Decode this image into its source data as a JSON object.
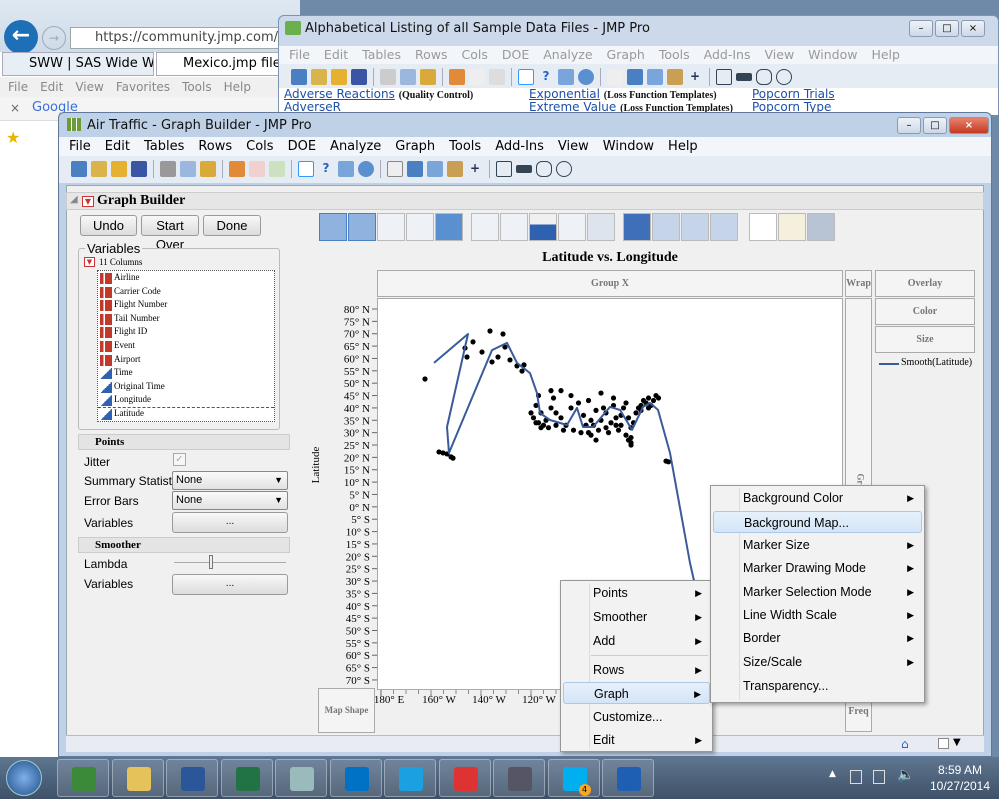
{
  "browser": {
    "address": "https://community.jmp.com/threa",
    "tabs": [
      "SWW | SAS Wide Web",
      "Mexico.jmp file H"
    ],
    "menu": [
      "File",
      "Edit",
      "View",
      "Favorites",
      "Tools",
      "Help"
    ],
    "google_close": "×",
    "google": "Google"
  },
  "listing_window": {
    "title": "Alphabetical Listing of all Sample Data Files - JMP Pro",
    "menu": [
      "File",
      "Edit",
      "Tables",
      "Rows",
      "Cols",
      "DOE",
      "Analyze",
      "Graph",
      "Tools",
      "Add-Ins",
      "View",
      "Window",
      "Help"
    ],
    "links": [
      {
        "name": "Adverse Reactions",
        "note": "(Quality Control)"
      },
      {
        "name": "AdverseR",
        "note": ""
      },
      {
        "name": "Exponential",
        "note": "(Loss Function Templates)"
      },
      {
        "name": "Extreme Value",
        "note": "(Loss Function Templates)"
      },
      {
        "name": "Popcorn Trials",
        "note": ""
      },
      {
        "name": "Popcorn Type",
        "note": ""
      }
    ]
  },
  "main_window": {
    "title": "Air Traffic - Graph Builder - JMP Pro",
    "menu": [
      "File",
      "Edit",
      "Tables",
      "Rows",
      "Cols",
      "DOE",
      "Analyze",
      "Graph",
      "Tools",
      "Add-Ins",
      "View",
      "Window",
      "Help"
    ]
  },
  "graph_builder": {
    "title": "Graph Builder",
    "buttons": {
      "undo": "Undo",
      "start_over": "Start Over",
      "done": "Done"
    },
    "variables_label": "Variables",
    "columns_label": "11 Columns",
    "columns": [
      {
        "name": "Airline",
        "type": "nominal"
      },
      {
        "name": "Carrier Code",
        "type": "nominal"
      },
      {
        "name": "Flight Number",
        "type": "nominal"
      },
      {
        "name": "Tail Number",
        "type": "nominal"
      },
      {
        "name": "Flight ID",
        "type": "nominal"
      },
      {
        "name": "Event",
        "type": "nominal"
      },
      {
        "name": "Airport",
        "type": "nominal"
      },
      {
        "name": "Time",
        "type": "continuous"
      },
      {
        "name": "Original Time",
        "type": "continuous"
      },
      {
        "name": "Longitude",
        "type": "continuous"
      },
      {
        "name": "Latitude",
        "type": "continuous"
      }
    ],
    "points": {
      "section": "Points",
      "jitter_label": "Jitter",
      "jitter_checked": true,
      "summary_label": "Summary Statistic",
      "summary_value": "None",
      "error_label": "Error Bars",
      "error_value": "None",
      "variables_label": "Variables",
      "variables_button": "..."
    },
    "smoother": {
      "section": "Smoother",
      "lambda_label": "Lambda",
      "lambda_value": 0.5,
      "variables_label": "Variables",
      "variables_button": "..."
    },
    "zones": {
      "group_x": "Group X",
      "wrap": "Wrap",
      "overlay": "Overlay",
      "color": "Color",
      "size": "Size",
      "map_shape": "Map Shape",
      "freq": "Freq",
      "group_y": "Gr"
    },
    "legend": "Smooth(Latitude)"
  },
  "chart_data": {
    "type": "scatter",
    "title": "Latitude vs. Longitude",
    "ylabel": "Latitude",
    "xlabel": "",
    "ylim": [
      -70,
      80
    ],
    "y_ticks": [
      "80° N",
      "75° N",
      "70° N",
      "65° N",
      "60° N",
      "55° N",
      "50° N",
      "45° N",
      "40° N",
      "35° N",
      "30° N",
      "25° N",
      "20° N",
      "15° N",
      "10° N",
      "5° N",
      "0° N",
      "5° S",
      "10° S",
      "15° S",
      "20° S",
      "25° S",
      "30° S",
      "35° S",
      "40° S",
      "45° S",
      "50° S",
      "55° S",
      "60° S",
      "65° S",
      "70° S"
    ],
    "x_ticks": [
      {
        "value": -180,
        "label": "180° E"
      },
      {
        "value": -160,
        "label": "160° W"
      },
      {
        "value": -140,
        "label": "140° W"
      },
      {
        "value": -120,
        "label": "120° W"
      }
    ],
    "grid": false,
    "series_color": "#3a5a9a",
    "points": [
      [
        -162.4,
        51.7
      ],
      [
        -146.4,
        64.2
      ],
      [
        -143.2,
        66.7
      ],
      [
        -145.6,
        60.6
      ],
      [
        -136.4,
        71.1
      ],
      [
        -131.2,
        69.9
      ],
      [
        -135.6,
        58.6
      ],
      [
        -139.6,
        62.6
      ],
      [
        -133.2,
        60.6
      ],
      [
        -130.4,
        64.6
      ],
      [
        -128.4,
        59.4
      ],
      [
        -125.6,
        57
      ],
      [
        -123.6,
        54.9
      ],
      [
        -122.8,
        57.4
      ],
      [
        -155.2,
        21.8
      ],
      [
        -153.6,
        21.4
      ],
      [
        -152,
        20.2
      ],
      [
        -151.2,
        19.7
      ],
      [
        -156.8,
        22.2
      ],
      [
        -118,
        41
      ],
      [
        -117,
        45
      ],
      [
        -116,
        38
      ],
      [
        -114,
        35
      ],
      [
        -112,
        47
      ],
      [
        -111,
        44
      ],
      [
        -110,
        33
      ],
      [
        -108,
        36
      ],
      [
        -106,
        33
      ],
      [
        -104,
        40
      ],
      [
        -103,
        31
      ],
      [
        -101,
        42
      ],
      [
        -99,
        37
      ],
      [
        -98,
        33
      ],
      [
        -97,
        30
      ],
      [
        -96,
        29
      ],
      [
        -95,
        33
      ],
      [
        -94,
        27
      ],
      [
        -93,
        31
      ],
      [
        -92,
        35
      ],
      [
        -91,
        40
      ],
      [
        -90,
        32
      ],
      [
        -89,
        30
      ],
      [
        -88,
        34
      ],
      [
        -87,
        41
      ],
      [
        -86,
        36
      ],
      [
        -85,
        31
      ],
      [
        -84,
        33
      ],
      [
        -83,
        40
      ],
      [
        -82,
        42
      ],
      [
        -81,
        36
      ],
      [
        -80,
        28
      ],
      [
        -80,
        26
      ],
      [
        -79,
        34
      ],
      [
        -78,
        38
      ],
      [
        -77,
        40
      ],
      [
        -76,
        41
      ],
      [
        -75,
        43
      ],
      [
        -74,
        42
      ],
      [
        -73,
        44
      ],
      [
        -72,
        41
      ],
      [
        -71,
        43
      ],
      [
        -70,
        45
      ],
      [
        -69,
        44
      ],
      [
        -117,
        34
      ],
      [
        -115,
        33
      ],
      [
        -120,
        38
      ],
      [
        -119,
        36
      ],
      [
        -113,
        32
      ],
      [
        -107,
        31
      ],
      [
        -100,
        30
      ],
      [
        -96,
        35
      ],
      [
        -90,
        38
      ],
      [
        -86,
        33
      ],
      [
        -84,
        37
      ],
      [
        -82,
        29
      ],
      [
        -80,
        32
      ],
      [
        -76,
        39
      ],
      [
        -73,
        40
      ],
      [
        -112,
        40
      ],
      [
        -108,
        47
      ],
      [
        -97,
        43
      ],
      [
        -92,
        46
      ],
      [
        -94,
        39
      ],
      [
        -87,
        44
      ],
      [
        -104,
        45
      ],
      [
        -118,
        34
      ],
      [
        -116,
        32
      ],
      [
        -110,
        38
      ],
      [
        -80,
        25
      ],
      [
        -81,
        27
      ],
      [
        -66,
        18.5
      ],
      [
        -65,
        18.2
      ]
    ],
    "smooth_line": {
      "name": "Smooth(Latitude)",
      "points": [
        [
          -158.8,
          58.2
        ],
        [
          -145.2,
          69.9
        ],
        [
          -153.6,
          32.3
        ],
        [
          -152.8,
          21.8
        ],
        [
          -135.6,
          63.4
        ],
        [
          -129.6,
          66.3
        ],
        [
          -125.6,
          58.2
        ],
        [
          -120.4,
          54.1
        ],
        [
          -117.6,
          46
        ],
        [
          -116.4,
          37.9
        ],
        [
          -112.4,
          35.1
        ],
        [
          -105.6,
          33.1
        ],
        [
          -101.6,
          40
        ],
        [
          -99.2,
          32.3
        ],
        [
          -95.2,
          32.3
        ],
        [
          -88.4,
          40.4
        ],
        [
          -84.4,
          39.2
        ],
        [
          -79.6,
          31.1
        ],
        [
          -75.2,
          40.4
        ],
        [
          -72.4,
          42
        ],
        [
          -69.2,
          39.2
        ],
        [
          -64.4,
          21.8
        ],
        [
          -56.4,
          -22.7
        ],
        [
          -54.4,
          -31.6
        ]
      ]
    }
  },
  "context_menu": {
    "items": [
      {
        "label": "Points",
        "submenu": true
      },
      {
        "label": "Smoother",
        "submenu": true
      },
      {
        "label": "Add",
        "submenu": true
      },
      {
        "label": "Rows",
        "submenu": true
      },
      {
        "label": "Graph",
        "submenu": true
      },
      {
        "label": "Customize...",
        "submenu": false
      },
      {
        "label": "Edit",
        "submenu": true
      }
    ],
    "highlighted": "Graph"
  },
  "graph_submenu": {
    "items": [
      {
        "label": "Background Color",
        "submenu": true
      },
      {
        "label": "Background Map...",
        "submenu": false
      },
      {
        "label": "Marker Size",
        "submenu": true
      },
      {
        "label": "Marker Drawing Mode",
        "submenu": true
      },
      {
        "label": "Marker Selection Mode",
        "submenu": true
      },
      {
        "label": "Line Width Scale",
        "submenu": true
      },
      {
        "label": "Border",
        "submenu": true
      },
      {
        "label": "Size/Scale",
        "submenu": true
      },
      {
        "label": "Transparency...",
        "submenu": false
      }
    ],
    "highlighted": "Background Map..."
  },
  "taskbar": {
    "apps": [
      "jmp",
      "file-explorer",
      "word",
      "excel",
      "presentation",
      "outlook",
      "internet-explorer",
      "snipping-tool",
      "terminal",
      "skype",
      "lync"
    ],
    "skype_badge": "4",
    "time": "8:59 AM",
    "date": "10/27/2014"
  }
}
